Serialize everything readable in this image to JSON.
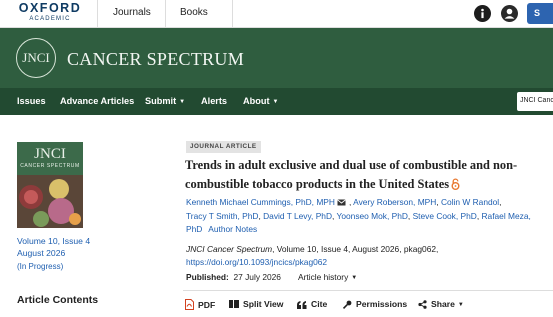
{
  "header": {
    "logo_line1": "OXFORD",
    "logo_line2": "ACADEMIC",
    "links": [
      "Journals",
      "Books"
    ],
    "info_icon": "info-icon",
    "user_icon": "user-icon",
    "sign_in_label": "S"
  },
  "banner": {
    "circle_text": "JNCI",
    "journal_name": "CANCER SPECTRUM",
    "background_color": "#2f5d3f"
  },
  "nav": {
    "items": [
      {
        "label": "Issues",
        "has_caret": false
      },
      {
        "label": "Advance Articles",
        "has_caret": false
      },
      {
        "label": "Submit",
        "has_caret": true
      },
      {
        "label": "Alerts",
        "has_caret": false
      },
      {
        "label": "About",
        "has_caret": true
      }
    ],
    "search_scope": "JNCI Cancer",
    "background_color": "#224a31"
  },
  "sidebar": {
    "cover_title": "JNCI",
    "cover_subtitle": "CANCER SPECTRUM",
    "volume_issue": "Volume 10, Issue 4",
    "issue_date": "August 2026",
    "status": "(In Progress)",
    "contents_heading": "Article Contents"
  },
  "article": {
    "type": "JOURNAL ARTICLE",
    "title": "Trends in adult exclusive and dual use of combustible and non-combustible tobacco products in the United States",
    "open_access_icon": "open-access-lock-icon",
    "authors": [
      "Kenneth Michael Cummings, PhD, MPH",
      "Avery Roberson, MPH",
      "Colin W Randol",
      "Tracy T Smith, PhD",
      "David T Levy, PhD",
      "Yoonseo Mok, PhD",
      "Steve Cook, PhD",
      "Rafael Meza, PhD"
    ],
    "author_notes": "Author Notes",
    "citation": {
      "journal": "JNCI Cancer Spectrum",
      "details": ", Volume 10, Issue 4, August 2026, pkag062,",
      "doi": "https://doi.org/10.1093/jncics/pkag062"
    },
    "published_label": "Published:",
    "published_date": "27 July 2026",
    "history_label": "Article history"
  },
  "toolbar": {
    "pdf": "PDF",
    "split_view": "Split View",
    "cite": "Cite",
    "permissions": "Permissions",
    "share": "Share"
  },
  "colors": {
    "link": "#1f5fb0",
    "pdf_red": "#d2401f",
    "open_access": "#e8772e"
  }
}
